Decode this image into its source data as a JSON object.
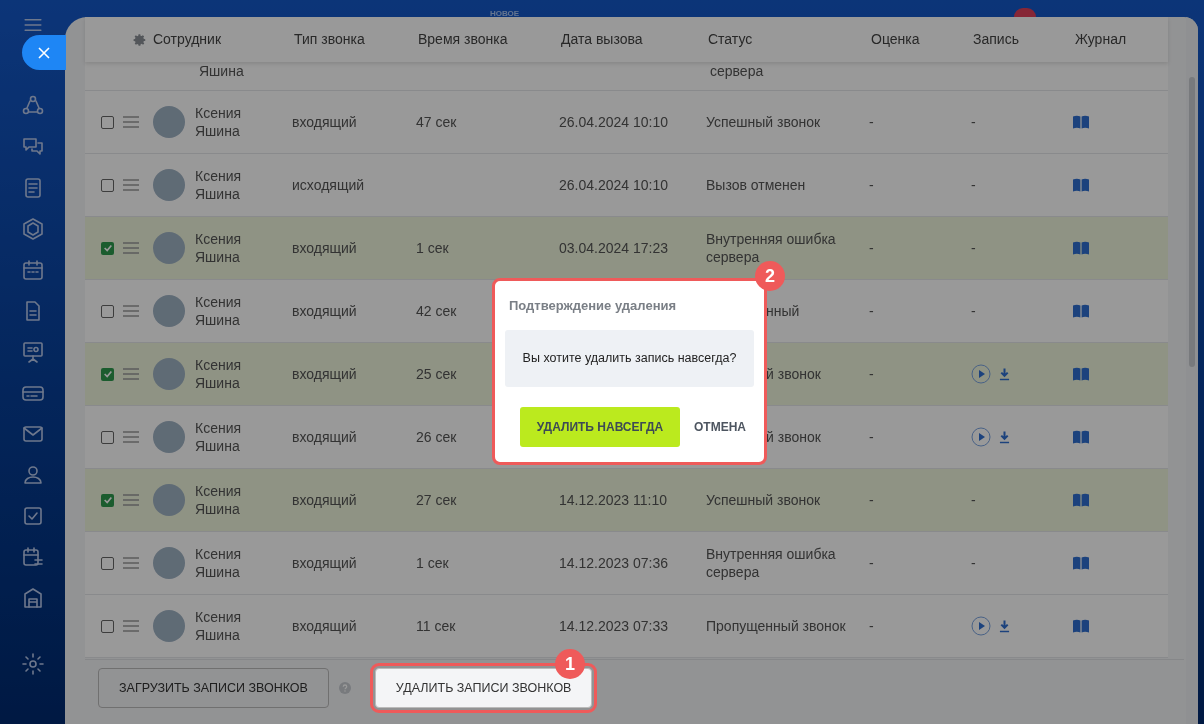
{
  "top_bar": {
    "label": "НОВОЕ"
  },
  "table": {
    "columns": [
      "Сотрудник",
      "Тип звонка",
      "Время звонка",
      "Дата вызова",
      "Статус",
      "Оценка",
      "Запись",
      "Журнал"
    ],
    "rows": [
      {
        "kind": "partial",
        "name": "Яшина",
        "status": "сервера"
      },
      {
        "kind": "full",
        "checked": false,
        "name": "Ксения Яшина",
        "type": "входящий",
        "duration": "47 сек",
        "date": "26.04.2024 10:10",
        "status": "Успешный звонок",
        "rating": "-",
        "recording": "-"
      },
      {
        "kind": "full",
        "checked": false,
        "name": "Ксения Яшина",
        "type": "исходящий",
        "date": "26.04.2024 10:10",
        "status": "Вызов отменен",
        "rating": "-",
        "recording": "-"
      },
      {
        "kind": "full",
        "checked": true,
        "name": "Ксения Яшина",
        "type": "входящий",
        "duration": "1 сек",
        "date": "03.04.2024 17:23",
        "status": "Внутренняя ошибка сервера",
        "rating": "-",
        "recording": "-"
      },
      {
        "kind": "full",
        "checked": false,
        "name": "Ксения Яшина",
        "type": "входящий",
        "duration": "42 сек",
        "status": "нный",
        "status_covered": true,
        "rating": "-",
        "recording": "-"
      },
      {
        "kind": "full",
        "checked": true,
        "name": "Ксения Яшина",
        "type": "входящий",
        "duration": "25 сек",
        "status": "й звонок",
        "status_covered": true,
        "rating": "-",
        "audio": true
      },
      {
        "kind": "full",
        "checked": false,
        "name": "Ксения Яшина",
        "type": "входящий",
        "duration": "26 сек",
        "status": "й звонок",
        "status_covered": true,
        "rating": "-",
        "audio": true
      },
      {
        "kind": "full",
        "checked": true,
        "name": "Ксения Яшина",
        "type": "входящий",
        "duration": "27 сек",
        "date": "14.12.2023 11:10",
        "status": "Успешный звонок",
        "rating": "-",
        "recording": "-"
      },
      {
        "kind": "full",
        "checked": false,
        "name": "Ксения Яшина",
        "type": "входящий",
        "duration": "1 сек",
        "date": "14.12.2023 07:36",
        "status": "Внутренняя ошибка сервера",
        "rating": "-",
        "recording": "-"
      },
      {
        "kind": "full",
        "checked": false,
        "name": "Ксения Яшина",
        "type": "входящий",
        "duration": "11 сек",
        "date": "14.12.2023 07:33",
        "status": "Пропущенный звонок",
        "rating": "-",
        "audio": true
      }
    ]
  },
  "footer": {
    "buttons": [
      {
        "label": "ЗАГРУЗИТЬ ЗАПИСИ ЗВОНКОВ",
        "highlighted": false
      },
      {
        "label": "УДАЛИТЬ ЗАПИСИ ЗВОНКОВ",
        "highlighted": true,
        "callout": "1"
      }
    ]
  },
  "dialog": {
    "title": "Подтверждение удаления",
    "message": "Вы хотите удалить запись навсегда?",
    "confirm": "УДАЛИТЬ НАВСЕГДА",
    "cancel": "ОТМЕНА",
    "callout": "2"
  }
}
